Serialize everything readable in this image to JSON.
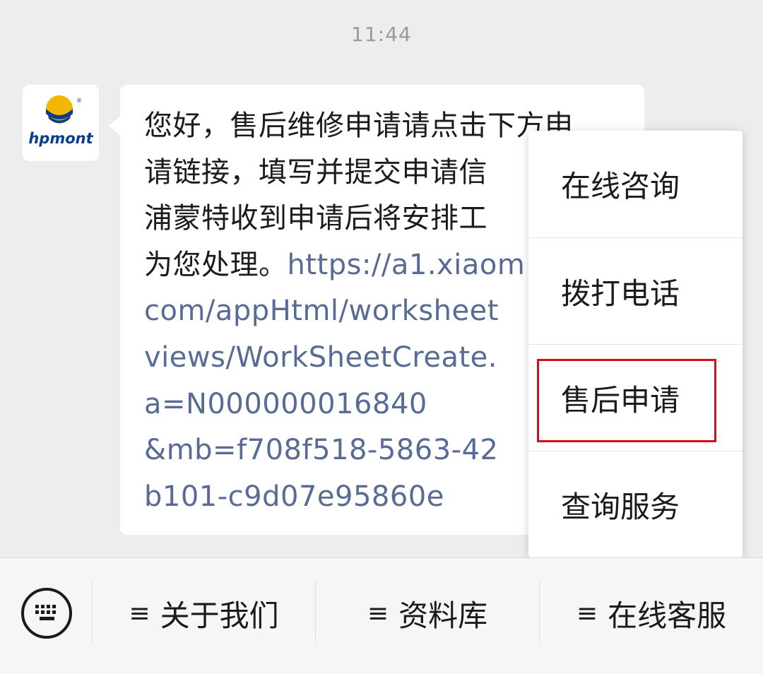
{
  "timestamp": "11:44",
  "avatar": {
    "logo_text": "hpmont",
    "registered": "®"
  },
  "message": {
    "text_line1": "您好，售后维修申请请点击下方申",
    "text_line2": "请链接，填写并提交申请信",
    "text_line3": "浦蒙特收到申请后将安排工",
    "text_line4": "为您处理。",
    "link_line1": "https://a1.xiaom",
    "link_line2": "com/appHtml/worksheet",
    "link_line3": "views/WorkSheetCreate.",
    "link_line4": "a=N000000016840",
    "link_line5": "&mb=f708f518-5863-42",
    "link_line6": "b101-c9d07e95860e"
  },
  "menu": {
    "items": [
      {
        "label": "在线咨询"
      },
      {
        "label": "拨打电话"
      },
      {
        "label": "售后申请"
      },
      {
        "label": "查询服务"
      }
    ]
  },
  "bottom_bar": {
    "menu_glyph": "≡",
    "btn1": "关于我们",
    "btn2": "资料库",
    "btn3": "在线客服"
  },
  "colors": {
    "link": "#576b95",
    "highlight": "#d0111b",
    "background": "#ededed",
    "logo_blue": "#0b3d8c",
    "logo_yellow": "#f2b705"
  }
}
